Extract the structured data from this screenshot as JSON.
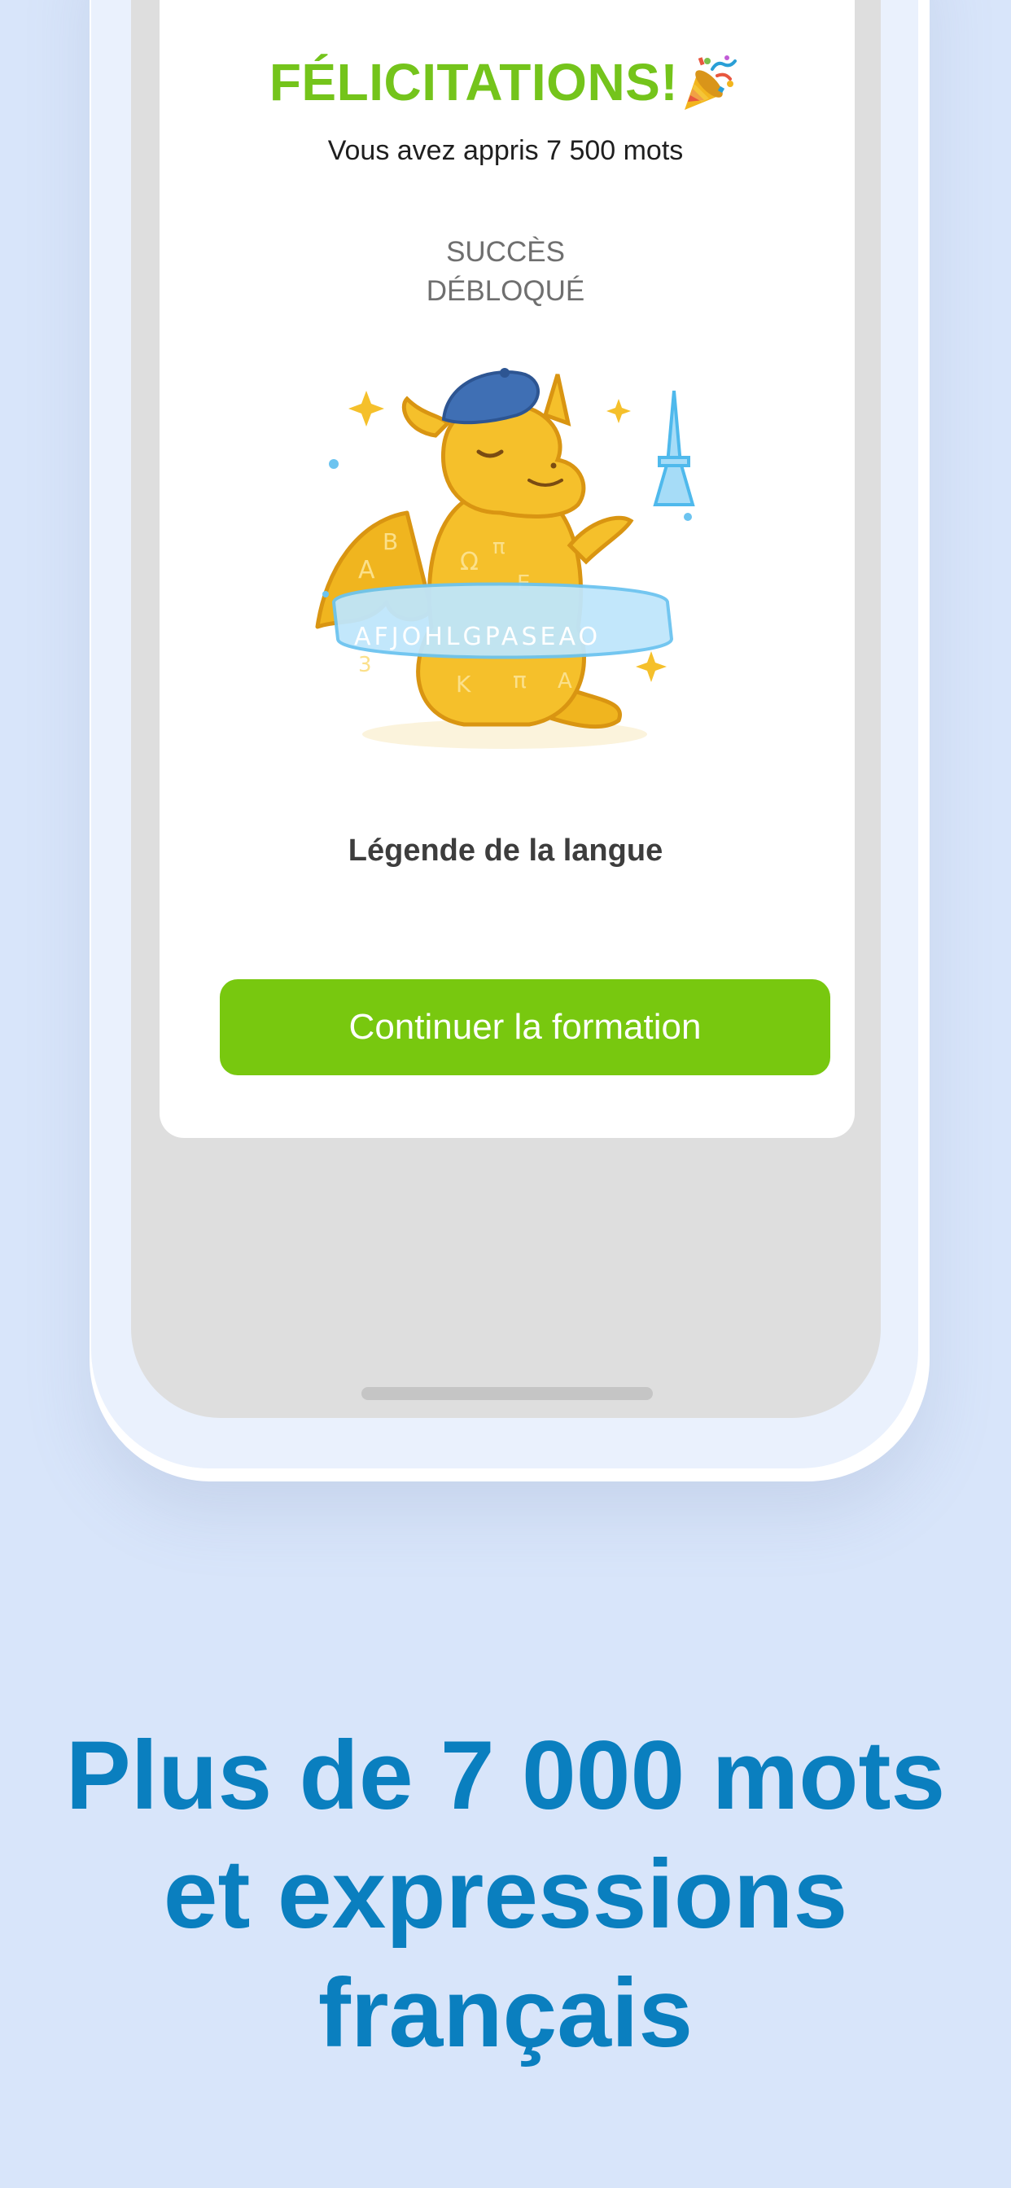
{
  "card": {
    "title": "FÉLICITATIONS!",
    "title_icon": "party-popper-icon",
    "words_learned": "Vous avez appris 7 500 mots",
    "achievement_label_line1": "SUCCÈS",
    "achievement_label_line2": "DÉBLOQUÉ",
    "badge_icon": "language-legend-dragon-badge",
    "badge_name": "Légende de la langue",
    "continue_label": "Continuer la formation"
  },
  "headline": {
    "line1": "Plus de 7 000 mots",
    "line2": "et expressions",
    "line3": "français"
  },
  "colors": {
    "background": "#d8e5fa",
    "title_green": "#74c41b",
    "button_green": "#78c80f",
    "headline_blue": "#0a7fbf"
  }
}
